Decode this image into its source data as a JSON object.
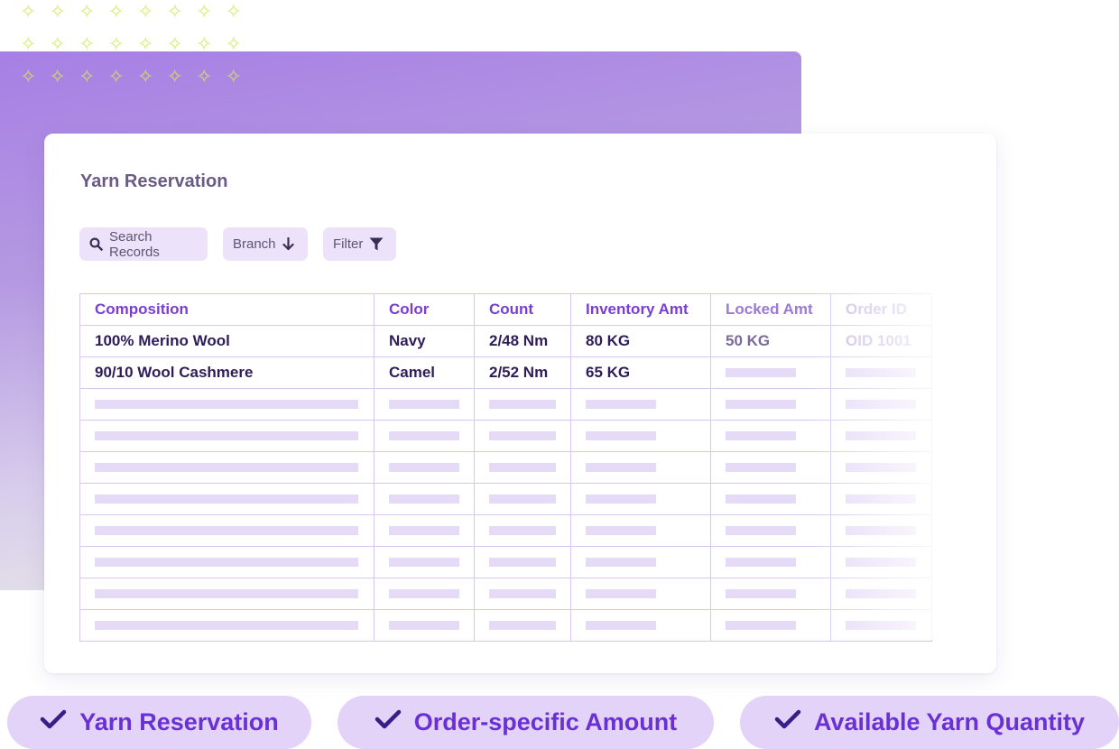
{
  "card": {
    "title": "Yarn Reservation"
  },
  "toolbar": {
    "search_label": "Search Records",
    "branch_label": "Branch",
    "filter_label": "Filter"
  },
  "table": {
    "headers": [
      "Composition",
      "Color",
      "Count",
      "Inventory Amt",
      "Locked Amt",
      "Order ID"
    ],
    "rows": [
      [
        "100% Merino Wool",
        "Navy",
        "2/48 Nm",
        "80 KG",
        "50 KG",
        "OID 1001"
      ],
      [
        "90/10 Wool Cashmere",
        "Camel",
        "2/52 Nm",
        "65 KG",
        "",
        ""
      ]
    ],
    "placeholder_rows": 8
  },
  "features": [
    {
      "label": "Yarn Reservation"
    },
    {
      "label": "Order-specific Amount"
    },
    {
      "label": "Available Yarn Quantity"
    }
  ],
  "colors": {
    "accent": "#6931d4",
    "header_text": "#7a3ed2",
    "pill_bg": "#e3d3f8",
    "toolbar_bg": "#ece2f9",
    "panel_gradient_top": "#a77fe4"
  },
  "icons": {
    "search": "search-icon",
    "branch": "arrow-down-icon",
    "filter": "filter-icon",
    "feature": "check-icon",
    "decoration": "sparkle-icon"
  }
}
